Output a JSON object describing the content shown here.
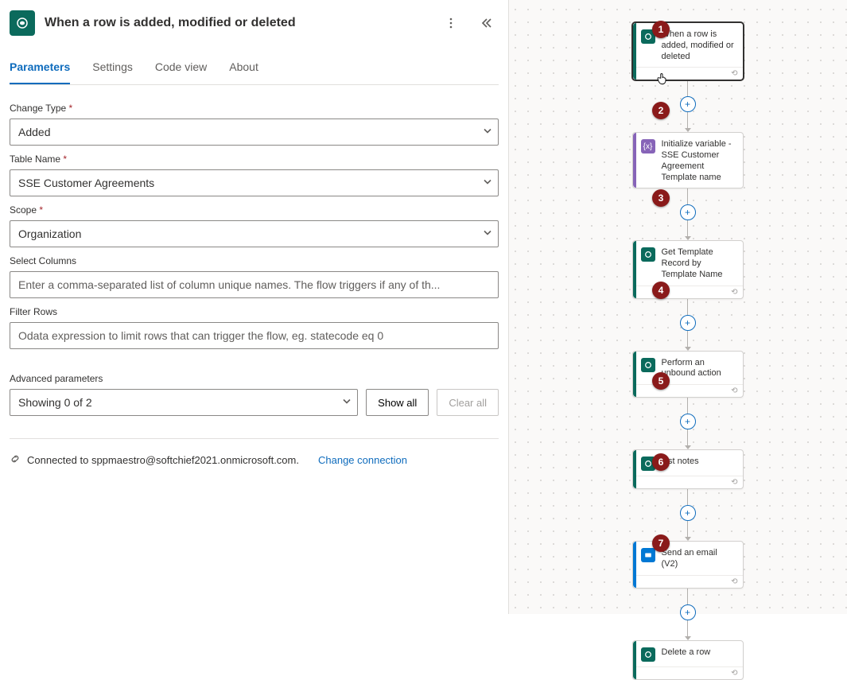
{
  "header": {
    "title": "When a row is added, modified or deleted"
  },
  "tabs": {
    "parameters": "Parameters",
    "settings": "Settings",
    "codeview": "Code view",
    "about": "About"
  },
  "fields": {
    "changeType": {
      "label": "Change Type",
      "value": "Added"
    },
    "tableName": {
      "label": "Table Name",
      "value": "SSE Customer Agreements"
    },
    "scope": {
      "label": "Scope",
      "value": "Organization"
    },
    "selectColumns": {
      "label": "Select Columns",
      "placeholder": "Enter a comma-separated list of column unique names. The flow triggers if any of th..."
    },
    "filterRows": {
      "label": "Filter Rows",
      "placeholder": "Odata expression to limit rows that can trigger the flow, eg. statecode eq 0"
    }
  },
  "advanced": {
    "label": "Advanced parameters",
    "showing": "Showing 0 of 2",
    "showAll": "Show all",
    "clearAll": "Clear all"
  },
  "connection": {
    "text": "Connected to sppmaestro@softchief2021.onmicrosoft.com.",
    "change": "Change connection"
  },
  "flowNodes": {
    "n1": "When a row is added, modified or deleted",
    "n2": "Initialize variable - SSE Customer Agreement Template name",
    "n3": "Get Template Record by Template Name",
    "n4": "Perform an unbound action",
    "n5": "List notes",
    "n6": "Send an email (V2)",
    "n7": "Delete a row"
  },
  "badges": {
    "b1": "1",
    "b2": "2",
    "b3": "3",
    "b4": "4",
    "b5": "5",
    "b6": "6",
    "b7": "7"
  },
  "colors": {
    "dataverse": "#0b6a5c",
    "variable": "#8764b8",
    "outlook": "#0078d4",
    "badge": "#8a1a1a"
  }
}
